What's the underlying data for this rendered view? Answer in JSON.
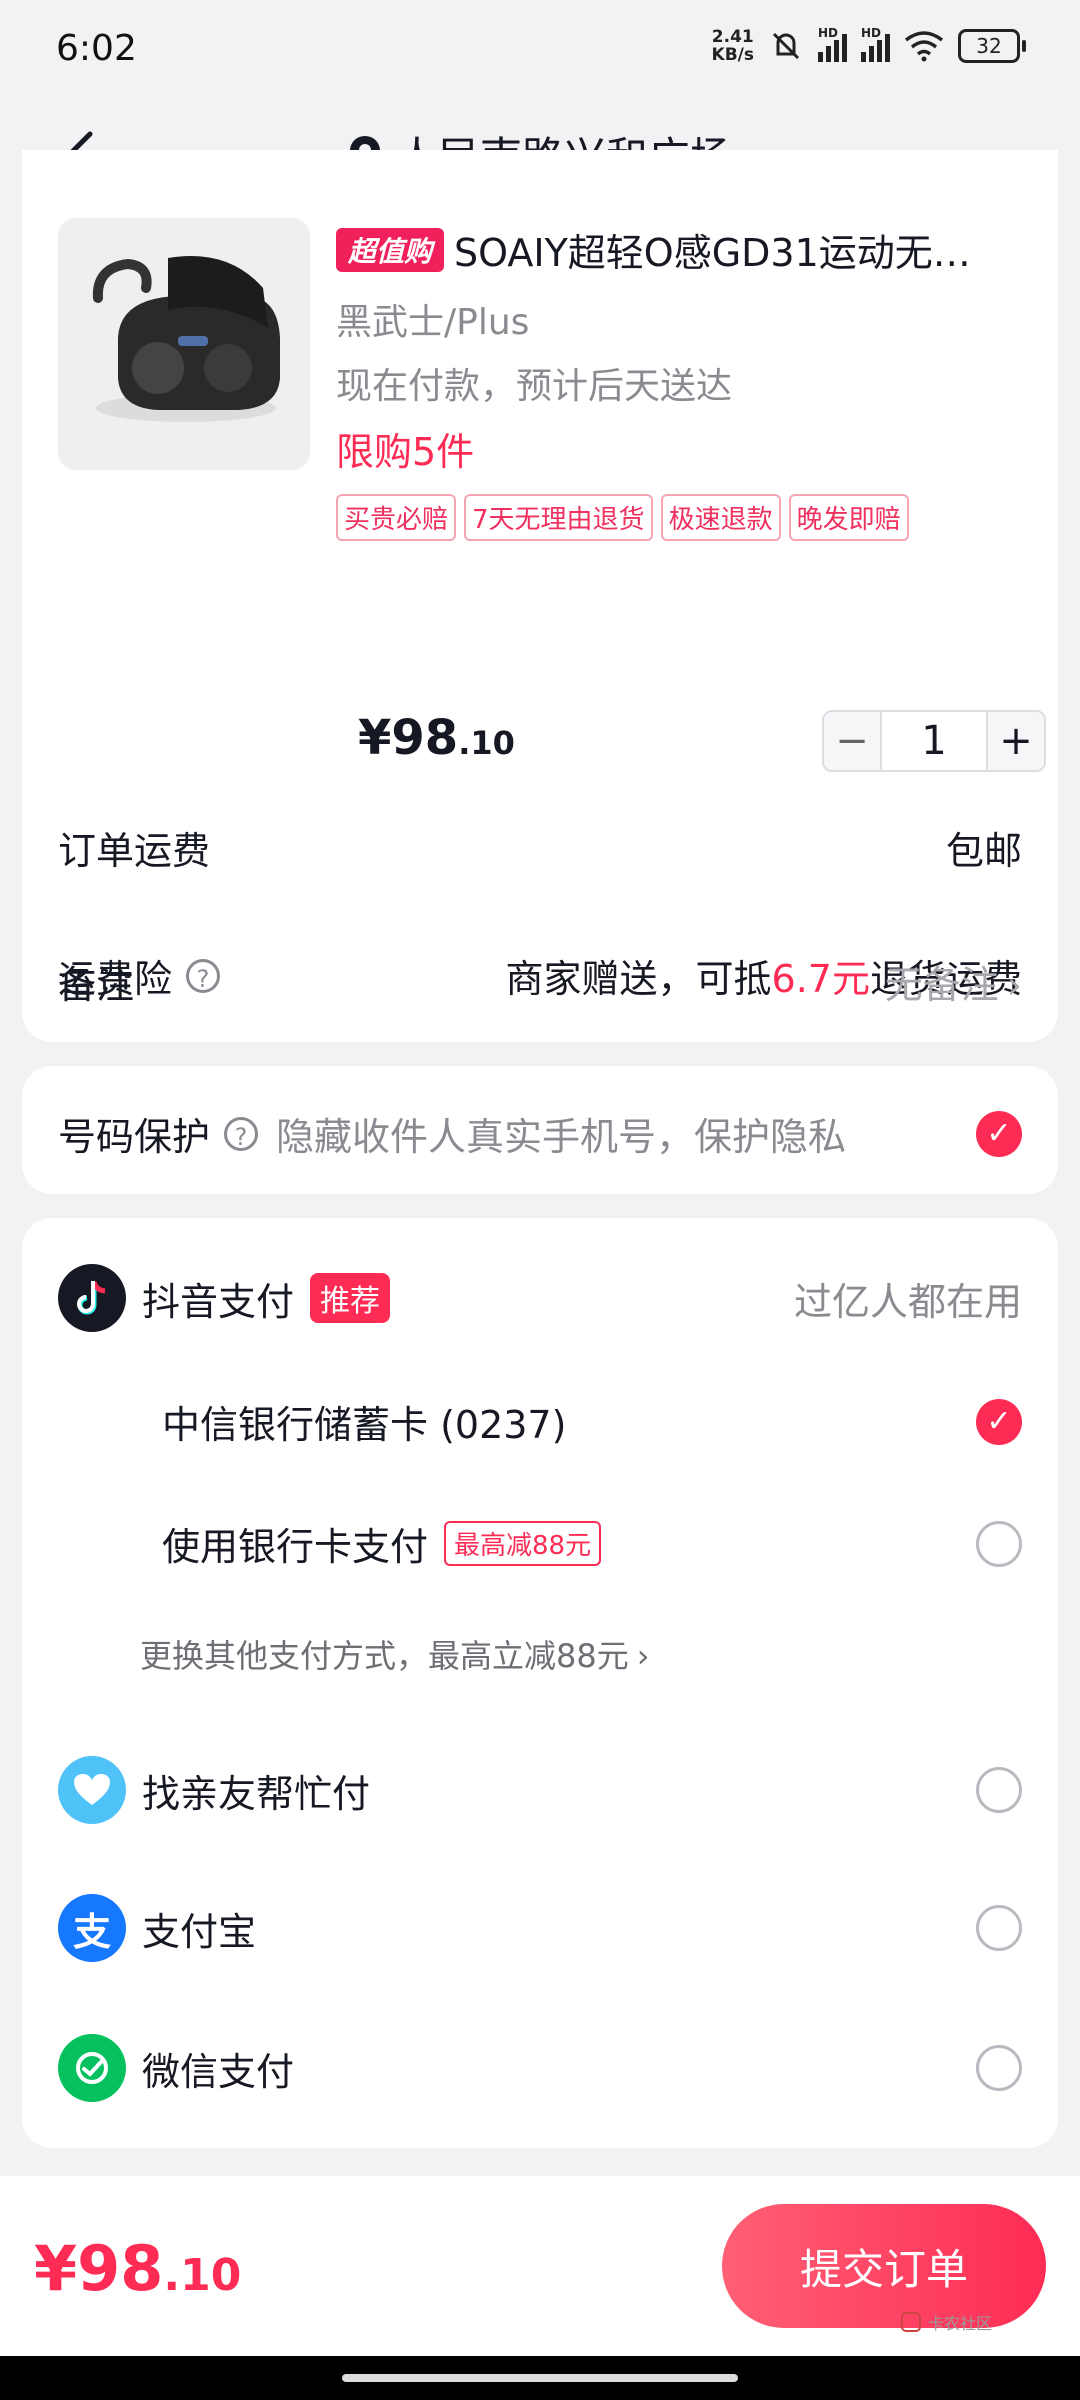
{
  "status": {
    "time": "6:02",
    "net_speed_top": "2.41",
    "net_speed_bottom": "KB/s",
    "hd1": "HD",
    "hd2": "HD",
    "battery": "32"
  },
  "header": {
    "location": "人民南路兴和广场"
  },
  "product": {
    "promo_tag": "超值购",
    "title": "SOAIY超轻O感GD31运动无…",
    "variant": "黑武士/Plus",
    "delivery": "现在付款，预计后天送达",
    "limit": "限购5件",
    "guarantees": [
      "买贵必赔",
      "7天无理由退货",
      "极速退款",
      "晚发即赔"
    ],
    "price_symbol": "¥",
    "price_int": "98",
    "price_dec": ".10",
    "qty": "1",
    "minus": "−",
    "plus": "+"
  },
  "order": {
    "shipping_label": "订单运费",
    "shipping_value": "包邮",
    "insurance_label": "运费险",
    "insurance_pre": "商家赠送，可抵",
    "insurance_amount": "6.7元",
    "insurance_post": "退货运费",
    "remark_label": "备注",
    "remark_value": "无备注"
  },
  "privacy": {
    "label": "号码保护",
    "desc": "隐藏收件人真实手机号，保护隐私"
  },
  "payment": {
    "douyin_label": "抖音支付",
    "douyin_tag": "推荐",
    "douyin_note": "过亿人都在用",
    "card_label": "中信银行储蓄卡 (0237)",
    "bankcard_label": "使用银行卡支付",
    "bankcard_tag": "最高减88元",
    "change_link": "更换其他支付方式，最高立减88元",
    "friend_label": "找亲友帮忙付",
    "alipay_label": "支付宝",
    "alipay_glyph": "支",
    "wechat_label": "微信支付"
  },
  "footer": {
    "total_symbol": "¥",
    "total_int": "98",
    "total_dec": ".10",
    "submit_label": "提交订单",
    "watermark": "卡农社区"
  },
  "colors": {
    "accent": "#fe2c55",
    "alipay": "#1677ff",
    "wechat": "#07c160",
    "friend": "#4fc3f7"
  }
}
